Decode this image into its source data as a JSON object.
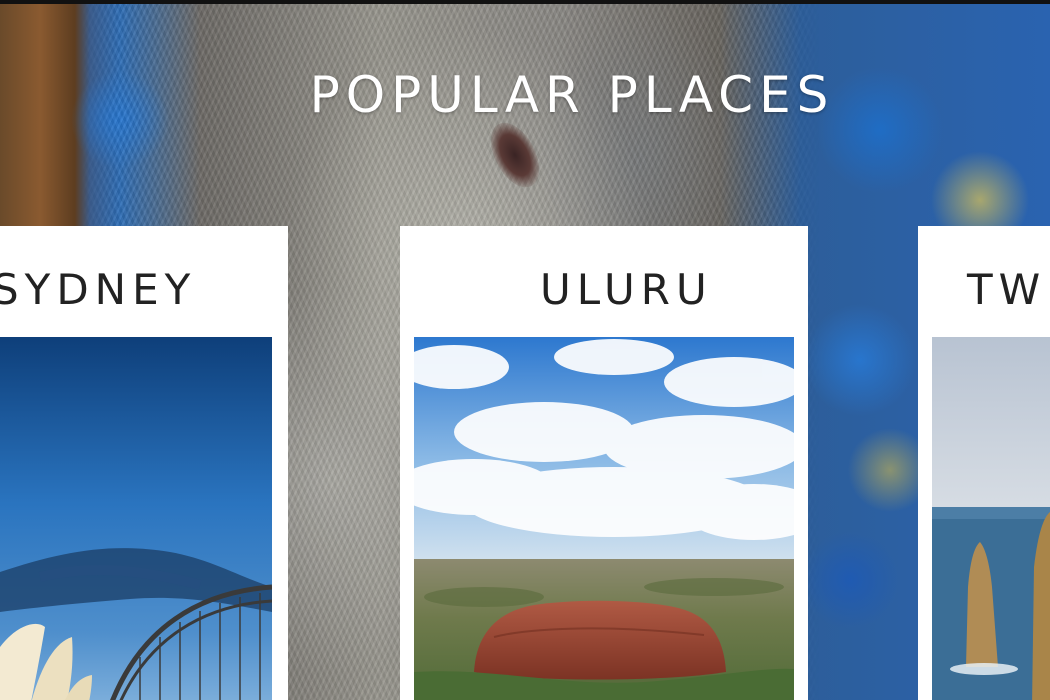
{
  "section": {
    "title": "POPULAR PLACES"
  },
  "cards": [
    {
      "label": "SYDNEY",
      "image": "sydney-harbour-photo"
    },
    {
      "label": "ULURU",
      "image": "uluru-aerial-photo"
    },
    {
      "label": "TWE",
      "image": "twelve-apostles-photo"
    }
  ],
  "colors": {
    "title_text": "#ffffff",
    "card_bg": "#ffffff",
    "card_text": "#222222",
    "sky_blue": "#2e78c8"
  }
}
